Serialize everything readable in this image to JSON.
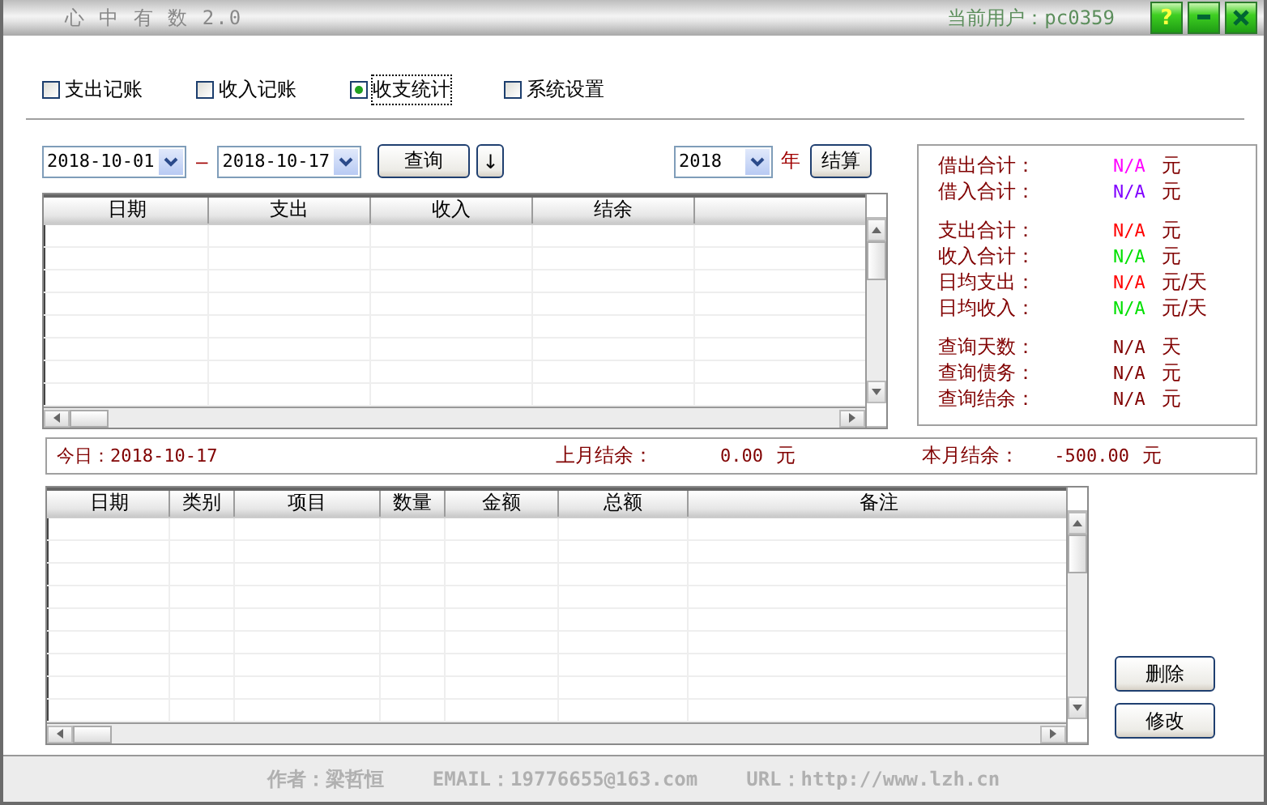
{
  "window": {
    "title": "心 中 有 数 2.0",
    "user": "当前用户：pc0359",
    "help_button": "?"
  },
  "tabs": [
    {
      "label": "支出记账",
      "selected": false
    },
    {
      "label": "收入记账",
      "selected": false
    },
    {
      "label": "收支统计",
      "selected": true
    },
    {
      "label": "系统设置",
      "selected": false
    }
  ],
  "query": {
    "from": "2018-10-01",
    "dash": "–",
    "to": "2018-10-17",
    "query_button": "查询",
    "sort_button": "↓",
    "year": "2018",
    "year_label": "年",
    "settle_button": "结算"
  },
  "summary_table": {
    "columns": [
      "日期",
      "支出",
      "收入",
      "结余"
    ]
  },
  "stats": [
    [
      {
        "label": "借出合计：",
        "value": "N/A",
        "unit": "元",
        "color": "#ff00ff"
      },
      {
        "label": "借入合计：",
        "value": "N/A",
        "unit": "元",
        "color": "#8000ff"
      }
    ],
    [
      {
        "label": "支出合计：",
        "value": "N/A",
        "unit": "元",
        "color": "#ff0000"
      },
      {
        "label": "收入合计：",
        "value": "N/A",
        "unit": "元",
        "color": "#00e000"
      },
      {
        "label": "日均支出：",
        "value": "N/A",
        "unit": "元/天",
        "color": "#ff0000"
      },
      {
        "label": "日均收入：",
        "value": "N/A",
        "unit": "元/天",
        "color": "#00e000"
      }
    ],
    [
      {
        "label": "查询天数：",
        "value": "N/A",
        "unit": "天",
        "color": "#800000"
      },
      {
        "label": "查询债务：",
        "value": "N/A",
        "unit": "元",
        "color": "#800000"
      },
      {
        "label": "查询结余：",
        "value": "N/A",
        "unit": "元",
        "color": "#800000"
      }
    ]
  ],
  "status": {
    "today": "今日：2018-10-17",
    "last_month": {
      "label": "上月结余：",
      "value": "0.00",
      "unit": "元"
    },
    "this_month": {
      "label": "本月结余：",
      "value": "-500.00",
      "unit": "元"
    }
  },
  "detail_table": {
    "columns": [
      "日期",
      "类别",
      "项目",
      "数量",
      "金额",
      "总额",
      "备注"
    ]
  },
  "buttons": [
    "删除",
    "修改"
  ],
  "footer": [
    "作者：梁哲恒",
    "EMAIL：19776655@163.com",
    "URL：http://www.lzh.cn"
  ]
}
